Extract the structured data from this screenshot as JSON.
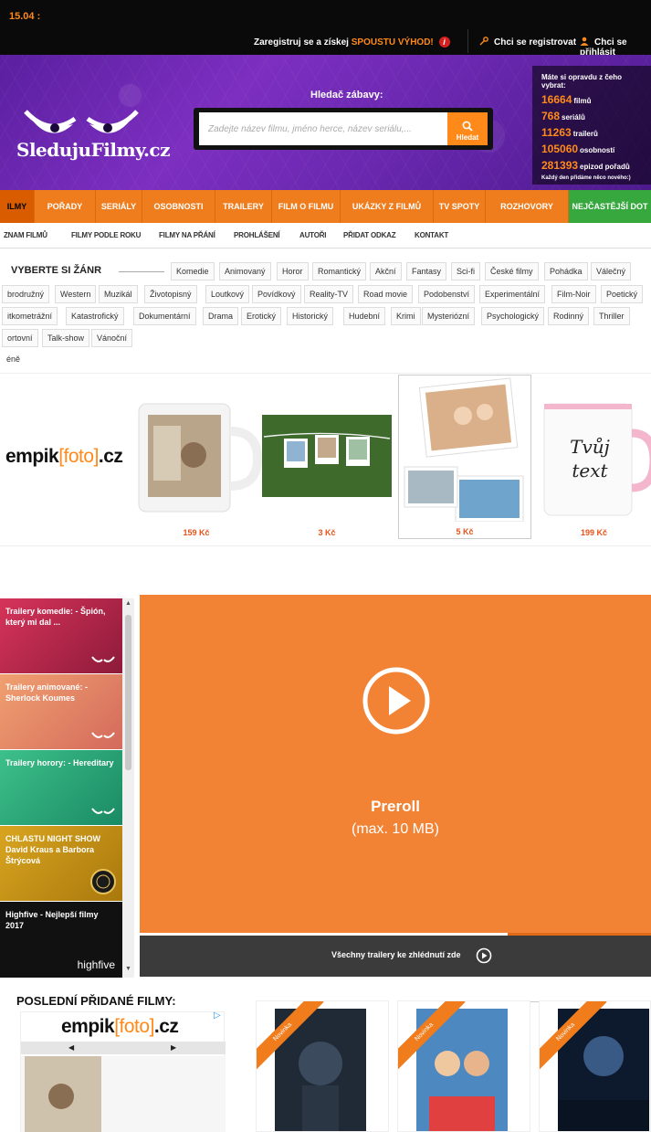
{
  "topbar": {
    "time": "15.04 :",
    "promo_text": "Zaregistruj se a získej",
    "promo_highlight": "SPOUSTU VÝHOD!",
    "promo_icon": "i",
    "register_link": "Chci se registrovat",
    "login_link": "Chci se přihlásit"
  },
  "header": {
    "logo_text": "SledujuFilmy.cz",
    "search_title": "Hledač zábavy:",
    "search_placeholder": "Zadejte název filmu, jméno herce, název seriálu,...",
    "search_button": "Hledat",
    "stats_lead": "Máte si opravdu z čeho vybrat:",
    "stats": [
      {
        "number": "16664",
        "label": "filmů"
      },
      {
        "number": "768",
        "label": "seriálů"
      },
      {
        "number": "11263",
        "label": "trailerů"
      },
      {
        "number": "105060",
        "label": "osobností"
      },
      {
        "number": "281393",
        "label": "epizod pořadů"
      }
    ],
    "stats_foot": "Každý den přidáme něco nového:)"
  },
  "mainnav": [
    "ILMY",
    "POŘADY",
    "SERIÁLY",
    "OSOBNOSTI",
    "TRAILERY",
    "FILM O FILMU",
    "UKÁZKY Z FILMŮ",
    "TV SPOTY",
    "ROZHOVORY",
    "NEJČASTĚJŠÍ DOT"
  ],
  "subnav": [
    "ZNAM FILMŮ",
    "FILMY PODLE ROKU",
    "FILMY NA PŘÁNÍ",
    "PROHLÁŠENÍ",
    "AUTOŘI",
    "PŘIDAT ODKAZ",
    "KONTAKT"
  ],
  "genre": {
    "title": "VYBERTE SI ŽÁNR",
    "row1": [
      "Komedie",
      "Animovaný",
      "Horor",
      "Romantický",
      "Akční",
      "Fantasy",
      "Sci-fi",
      "České filmy",
      "Pohádka",
      "Válečný"
    ],
    "row2": [
      "brodružný",
      "Western",
      "Muzikál",
      "Životopisný",
      "Loutkový",
      "Povídkový",
      "Reality-TV",
      "Road movie",
      "Podobenství",
      "Experimentální",
      "Film-Noir",
      "Poetický"
    ],
    "row3": [
      "itkometrážní",
      "Katastrofický",
      "Dokumentární",
      "Drama",
      "Erotický",
      "Historický",
      "Hudební",
      "Krimi",
      "Mysteriózní",
      "Psychologický",
      "Rodinný",
      "Thriller"
    ],
    "row4": [
      "ortovní",
      "Talk-show",
      "Vánoční"
    ],
    "row5": [
      "éně"
    ]
  },
  "ad_strip": {
    "brand": "empik",
    "brand_mid": "foto",
    "brand_suffix": ".cz",
    "products": [
      {
        "price": "159 Kč"
      },
      {
        "price": "3 Kč"
      },
      {
        "price": "5 Kč"
      },
      {
        "price": "199 Kč",
        "mug_text": "Tvůj text"
      }
    ]
  },
  "trailers": [
    {
      "title": "Trailery komedie: - Špión, který mi dal ...",
      "color": "#c0264a"
    },
    {
      "title": "Trailery animované: - Sherlock Koumes",
      "color": "#e88a5a"
    },
    {
      "title": "Trailery horory: - Hereditary",
      "color": "#2fb07a"
    },
    {
      "title": "CHLASTU NIGHT SHOW David Kraus a Barbora Štrýcová",
      "color": "#c49416"
    },
    {
      "title": "Highfive - Nejlepší filmy 2017",
      "color": "#1a1a1a",
      "logo": "highfive"
    }
  ],
  "player": {
    "label": "Preroll",
    "sub": "(max. 10 MB)",
    "bar_text": "Všechny trailery ke zhlédnutí zde",
    "progress": 0.72
  },
  "latest": {
    "title": "POSLEDNÍ PŘIDANÉ FILMY:",
    "ribbon": "Novinka"
  },
  "colors": {
    "accent": "#ef7d1d",
    "brand_purple": "#6a28b0",
    "green": "#37a83e"
  }
}
